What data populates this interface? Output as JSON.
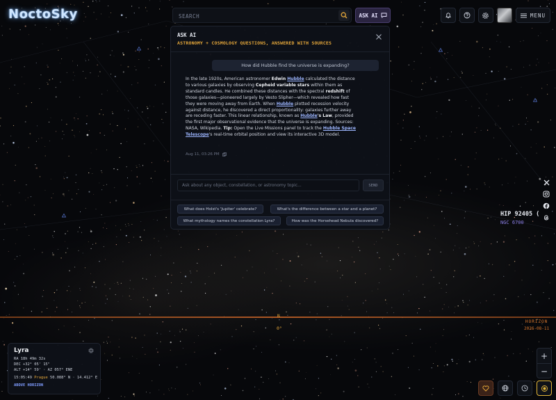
{
  "app": {
    "title": "NoctoSky"
  },
  "search": {
    "placeholder": "SEARCH",
    "icon": "search-icon"
  },
  "ask_ai_button": {
    "label": "ASK AI",
    "icon": "chat-icon"
  },
  "header": {
    "icons": [
      "bell-icon",
      "help-icon",
      "gear-icon"
    ],
    "menu_label": "MENU"
  },
  "ask_panel": {
    "title": "ASK AI",
    "subtitle": "ASTRONOMY + COSMOLOGY QUESTIONS, ANSWERED WITH SOURCES",
    "question": "How did Hubble find the universe is expanding?",
    "answer": {
      "p1": "In the late 1920s, American astronomer ",
      "edwin": "Edwin",
      "hubble1": "Hubble",
      "p2": " calculated the distance to various galaxies by observing ",
      "cepheid": "Cepheid variable stars",
      "p3": " within them as standard candles. He combined these distances with the spectral ",
      "redshift": "redshift",
      "p4": " of those galaxies—pioneered largely by Vesto Slipher—which revealed how fast they were moving away from Earth. When ",
      "hubble2": "Hubble",
      "p5": " plotted recession velocity against distance, he discovered a direct proportionality: galaxies further away are receding faster. This linear relationship, known as ",
      "hubble3": "Hubble",
      "p6": "'s Law",
      "p7": ", provided the first major observational evidence that the universe is expanding. Sources: NASA, Wikipedia. ",
      "tip": "Tip:",
      "p8": " Open the Live Missions panel to track the ",
      "telescope": "Hubble Space Telescope",
      "p9": "'s real-time orbital position and view its interactive 3D model."
    },
    "timestamp": "Aug 11, 03:26 PM",
    "input_placeholder": "Ask about any object, constellation, or astronomy topic...",
    "send_label": "SEND",
    "suggestions": [
      "What does Holst's 'Jupiter' celebrate?",
      "What's the difference between a star and a planet?",
      "What mythology names the constellation Lyra?",
      "How was the Horsehead Nebula discovered?"
    ]
  },
  "social": [
    "x-icon",
    "instagram-icon",
    "facebook-icon",
    "threads-icon"
  ],
  "sky_labels": {
    "hip": "HIP 92405 (",
    "ngc": "NGC 6700",
    "north": "N",
    "north_deg": "0°",
    "horizon": "HORIZON",
    "date": "2026-08-11"
  },
  "object_info": {
    "name": "Lyra",
    "ra": "RA 18h 49m 32s",
    "dec": "DEC +32° 05' 15\"",
    "altaz": "ALT +14° 59' · AZ 057° ENE",
    "time": "15:05:49",
    "city": "Prague",
    "coords": "50.088° N · 14.412° E",
    "status": "ABOVE HORIZON"
  },
  "zoom": {
    "in": "+",
    "out": "−"
  },
  "colors": {
    "accent_gold": "#e5a73a",
    "accent_purple": "#4a3f70",
    "link_blue": "#9db6ff",
    "horizon": "#c8642a"
  }
}
